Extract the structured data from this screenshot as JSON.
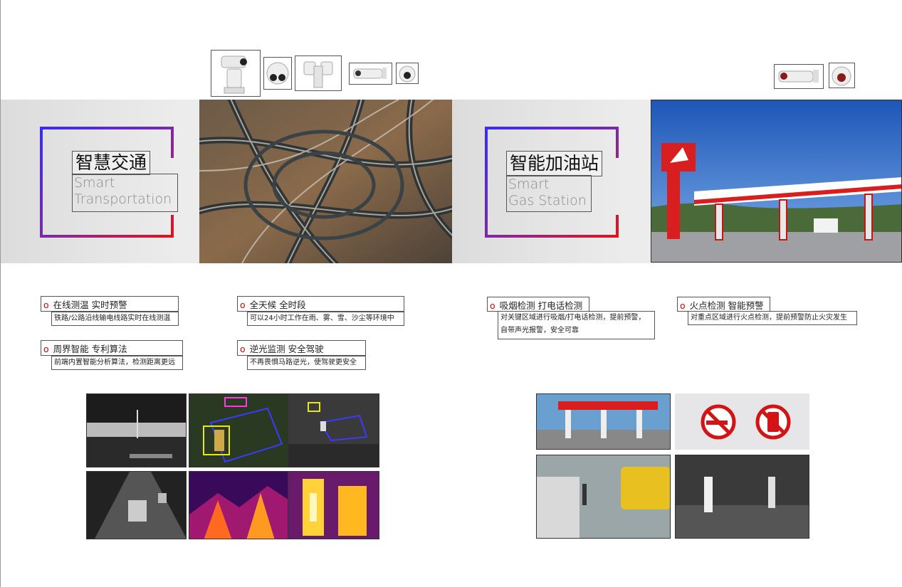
{
  "left": {
    "title_cn": "智慧交通",
    "title_en_1": "Smart",
    "title_en_2": "Transportation",
    "features": [
      {
        "heading": "在线测温  实时预警",
        "desc": "铁路/公路沿线输电线路实时在线测温"
      },
      {
        "heading": "全天候  全时段",
        "desc": "可以24小时工作在雨、雾、雪、沙尘等环境中"
      },
      {
        "heading": "周界智能  专利算法",
        "desc": "前端内置智能分析算法，检测距离更远"
      },
      {
        "heading": "逆光监测  安全驾驶",
        "desc": "不再畏惧马路逆光，使驾驶更安全"
      }
    ]
  },
  "right": {
    "title_cn": "智能加油站",
    "title_en_1": "Smart",
    "title_en_2": "Gas Station",
    "features": [
      {
        "heading": "吸烟检测  打电话检测",
        "desc_1": "对关键区域进行吸烟/打电话检测，提前预警，",
        "desc_2": "自带声光报警，安全可靠"
      },
      {
        "heading": "火点检测  智能预警",
        "desc": "对重点区域进行火点检测，提前预警防止火灾发生"
      }
    ]
  },
  "bullet": "o",
  "colors": {
    "accent_red": "#d60000",
    "gradient_blue": "#3a2cf0",
    "gradient_red": "#e0141e"
  }
}
